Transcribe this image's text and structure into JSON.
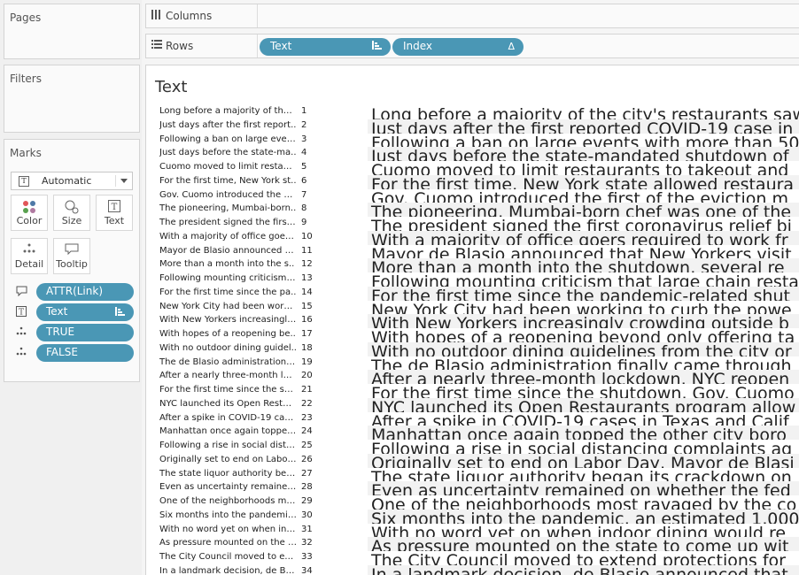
{
  "pages": {
    "title": "Pages"
  },
  "filters": {
    "title": "Filters"
  },
  "marks": {
    "title": "Marks",
    "mark_type": "Automatic",
    "buttons": {
      "color": "Color",
      "size": "Size",
      "text": "Text",
      "detail": "Detail",
      "tooltip": "Tooltip"
    },
    "pills": [
      {
        "label": "ATTR(Link)",
        "icon": "tooltip-icon"
      },
      {
        "label": "Text",
        "icon": "text-icon",
        "sorted": true
      },
      {
        "label": "TRUE",
        "icon": "detail-icon"
      },
      {
        "label": "FALSE",
        "icon": "detail-icon"
      }
    ]
  },
  "shelves": {
    "columns": {
      "label": "Columns"
    },
    "rows": {
      "label": "Rows",
      "pills": [
        {
          "label": "Text",
          "sort": "bar-sort-icon"
        },
        {
          "label": "Index",
          "sort": "delta-icon"
        }
      ]
    }
  },
  "sheet": {
    "title": "Text",
    "rows": [
      {
        "short": "Long before a majority of the ..",
        "index": "1",
        "full": "Long before a majority of the city's restaurants saw"
      },
      {
        "short": "Just days after the first report..",
        "index": "2",
        "full": "Just days after the first reported COVID-19 case in"
      },
      {
        "short": "Following a ban on large even..",
        "index": "3",
        "full": "Following a ban on large events with more than 50"
      },
      {
        "short": "Just days before the state-ma..",
        "index": "4",
        "full": "Just days before the state-mandated shutdown of"
      },
      {
        "short": "Cuomo moved to limit restaur..",
        "index": "5",
        "full": "Cuomo moved to limit restaurants to takeout and"
      },
      {
        "short": "For the first time, New York st..",
        "index": "6",
        "full": "For the first time, New York state allowed restaura"
      },
      {
        "short": "Gov. Cuomo introduced the fir..",
        "index": "7",
        "full": "Gov. Cuomo introduced the first of the eviction m"
      },
      {
        "short": "The pioneering, Mumbai-born..",
        "index": "8",
        "full": "The pioneering, Mumbai-born chef was one of the"
      },
      {
        "short": "The president signed the first ..",
        "index": "9",
        "full": "The president signed the first coronavirus relief bi"
      },
      {
        "short": "With a majority of office goers..",
        "index": "10",
        "full": "With a majority of office goers required to work fr"
      },
      {
        "short": "Mayor de Blasio announced th..",
        "index": "11",
        "full": "Mayor de Blasio announced that New Yorkers visit"
      },
      {
        "short": "More than a month into the s..",
        "index": "12",
        "full": "More than a month into the shutdown, several re"
      },
      {
        "short": "Following mounting criticism t..",
        "index": "13",
        "full": "Following mounting criticism that large chain resta"
      },
      {
        "short": "For the first time since the pa..",
        "index": "14",
        "full": "For the first time since the pandemic-related shut"
      },
      {
        "short": "New York City had been worki..",
        "index": "15",
        "full": "New York City had been working to curb the powe"
      },
      {
        "short": "With New Yorkers increasingly..",
        "index": "16",
        "full": "With New Yorkers increasingly crowding outside b"
      },
      {
        "short": "With hopes of a reopening be..",
        "index": "17",
        "full": "With hopes of a reopening beyond only offering ta"
      },
      {
        "short": "With no outdoor dining guidel..",
        "index": "18",
        "full": "With no outdoor dining guidelines from the city or"
      },
      {
        "short": "The de Blasio administration fi..",
        "index": "19",
        "full": "The de Blasio administration finally came through"
      },
      {
        "short": "After a nearly three-month loc..",
        "index": "20",
        "full": "After a nearly three-month lockdown, NYC reopen"
      },
      {
        "short": "For the first time since the shu..",
        "index": "21",
        "full": "For the first time since the shutdown, Gov. Cuomo"
      },
      {
        "short": "NYC launched its Open Restau..",
        "index": "22",
        "full": "NYC launched its Open Restaurants program allow"
      },
      {
        "short": "After a spike in COVID-19 case..",
        "index": "23",
        "full": "After a spike in COVID-19 cases in Texas and Calif"
      },
      {
        "short": "Manhattan once again topped..",
        "index": "24",
        "full": "Manhattan once again topped the other city boro"
      },
      {
        "short": "Following a rise in social dista..",
        "index": "25",
        "full": "Following a rise in social distancing complaints ag"
      },
      {
        "short": "Originally set to end on Labor ..",
        "index": "26",
        "full": "Originally set to end on Labor Day, Mayor de Blasi"
      },
      {
        "short": "The state liquor authority beg..",
        "index": "27",
        "full": "The state liquor authority began its crackdown on"
      },
      {
        "short": "Even as uncertainty remained ..",
        "index": "28",
        "full": "Even as uncertainty remained on whether the fed"
      },
      {
        "short": "One of the neighborhoods mo..",
        "index": "29",
        "full": "One of the neighborhoods most ravaged by the co"
      },
      {
        "short": "Six months into the pandemic,..",
        "index": "30",
        "full": "Six months into the pandemic, an estimated 1,000"
      },
      {
        "short": "With no word yet on when ind..",
        "index": "31",
        "full": "With no word yet on when indoor dining would re"
      },
      {
        "short": "As pressure mounted on the s..",
        "index": "32",
        "full": "As pressure mounted on the state to come up wit"
      },
      {
        "short": "The City Council moved to ext..",
        "index": "33",
        "full": "The City Council moved to extend protections for"
      },
      {
        "short": "In a landmark decision, de Bla..",
        "index": "34",
        "full": "In a landmark decision, de Blasio announced that"
      }
    ]
  }
}
